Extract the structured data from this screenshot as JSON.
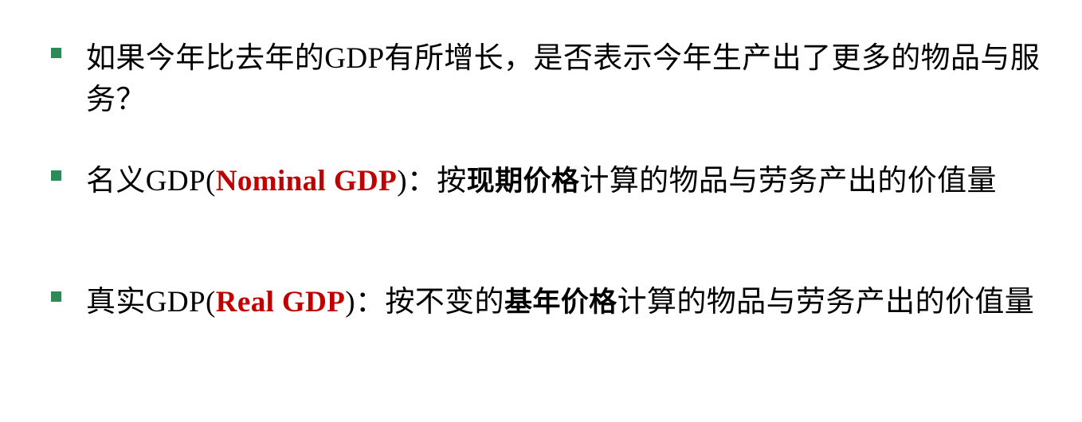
{
  "bullets": [
    {
      "text": "如果今年比去年的GDP有所增长，是否表示今年生产出了更多的物品与服务？"
    },
    {
      "prefix": "名义GDP(",
      "term_en": "Nominal GDP",
      "mid": ")：按",
      "term_cn": "现期价格",
      "suffix": "计算的物品与劳务产出的价值量"
    },
    {
      "prefix": "真实GDP(",
      "term_en": "Real GDP",
      "mid": ")：按不变的",
      "term_cn": "基年价格",
      "suffix": "计算的物品与劳务产出的价值量"
    }
  ],
  "colors": {
    "bullet": "#2e8b57",
    "highlight": "#c00000"
  }
}
